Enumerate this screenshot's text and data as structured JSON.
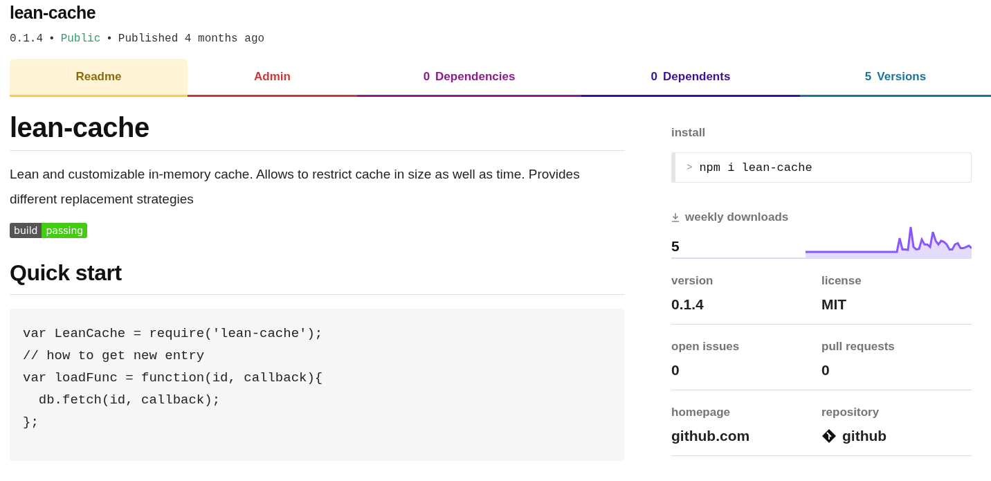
{
  "package": {
    "name": "lean-cache",
    "version": "0.1.4",
    "separator": "•",
    "visibility": "Public",
    "published": "Published 4 months ago"
  },
  "tabs": [
    {
      "label": "Readme",
      "color": "#8a6d0b",
      "selected": true
    },
    {
      "label": "Admin",
      "color": "#cb3837",
      "selected": false
    },
    {
      "count": "0",
      "label": "Dependencies",
      "color": "#8e1a8e",
      "selected": false
    },
    {
      "count": "0",
      "label": "Dependents",
      "color": "#3c0f9c",
      "selected": false
    },
    {
      "count": "5",
      "label": "Versions",
      "color": "#19759b",
      "selected": false
    }
  ],
  "readme": {
    "title": "lean-cache",
    "description": "Lean and customizable in-memory cache. Allows to restrict cache in size as well as time. Provides different replacement strategies",
    "badge": {
      "label": "build",
      "status": "passing"
    },
    "section_title": "Quick start",
    "code": [
      "var LeanCache = require('lean-cache');",
      "// how to get new entry",
      "var loadFunc = function(id, callback){",
      "  db.fetch(id, callback);",
      "};"
    ]
  },
  "sidebar": {
    "install_label": "install",
    "install_prompt": ">",
    "install_command": "npm i lean-cache",
    "downloads_label": "weekly downloads",
    "downloads_value": "5",
    "stats": [
      {
        "label": "version",
        "value": "0.1.4"
      },
      {
        "label": "license",
        "value": "MIT"
      },
      {
        "label": "open issues",
        "value": "0"
      },
      {
        "label": "pull requests",
        "value": "0"
      },
      {
        "label": "homepage",
        "value": "github.com"
      },
      {
        "label": "repository",
        "value": "github",
        "kind": "repo"
      }
    ]
  }
}
